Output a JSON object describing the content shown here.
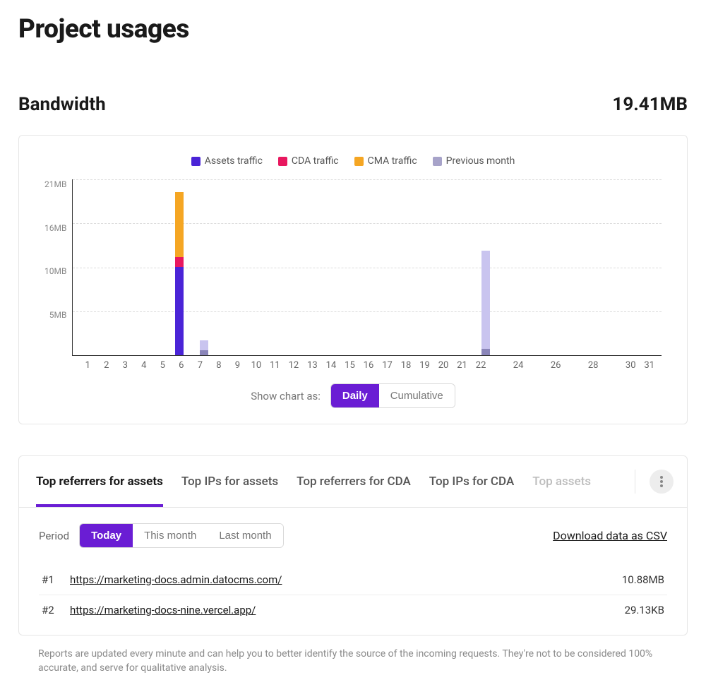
{
  "page": {
    "title": "Project usages"
  },
  "bandwidth": {
    "title": "Bandwidth",
    "total": "19.41MB"
  },
  "chart_data": {
    "type": "bar",
    "ylabel": "",
    "xlabel": "",
    "y_ticks": [
      "21MB",
      "16MB",
      "10MB",
      "5MB",
      ""
    ],
    "y_max_mb": 21,
    "categories": [
      "1",
      "2",
      "3",
      "4",
      "5",
      "6",
      "7",
      "8",
      "9",
      "10",
      "11",
      "12",
      "13",
      "14",
      "15",
      "16",
      "17",
      "18",
      "19",
      "20",
      "21",
      "22",
      "",
      "24",
      "",
      "26",
      "",
      "28",
      "",
      "30",
      "31"
    ],
    "legend": [
      {
        "name": "Assets traffic",
        "color": "#4a24d7"
      },
      {
        "name": "CDA traffic",
        "color": "#e8185f"
      },
      {
        "name": "CMA traffic",
        "color": "#f5a623"
      },
      {
        "name": "Previous month",
        "color": "#a7a3c9"
      }
    ],
    "series": [
      {
        "name": "Assets traffic",
        "values_mb": [
          0,
          0,
          0,
          0,
          0,
          10.5,
          0,
          0,
          0,
          0,
          0,
          0,
          0,
          0,
          0,
          0,
          0,
          0,
          0,
          0,
          0,
          0,
          0,
          0,
          0,
          0,
          0,
          0,
          0,
          0,
          0
        ]
      },
      {
        "name": "CDA traffic",
        "values_mb": [
          0,
          0,
          0,
          0,
          0,
          1.2,
          0,
          0,
          0,
          0,
          0,
          0,
          0,
          0,
          0,
          0,
          0,
          0,
          0,
          0,
          0,
          0,
          0,
          0,
          0,
          0,
          0,
          0,
          0,
          0,
          0
        ]
      },
      {
        "name": "CMA traffic",
        "values_mb": [
          0,
          0,
          0,
          0,
          0,
          7.7,
          0,
          0,
          0,
          0,
          0,
          0,
          0,
          0,
          0,
          0,
          0,
          0,
          0,
          0,
          0,
          0,
          0,
          0,
          0,
          0,
          0,
          0,
          0,
          0,
          0
        ]
      }
    ],
    "previous_month_mb": [
      0,
      0,
      0,
      0,
      0,
      0,
      1.8,
      0,
      0,
      0,
      0,
      0,
      0,
      0,
      0,
      0,
      0,
      0,
      0,
      0,
      0,
      12.5,
      0,
      0,
      0,
      0,
      0,
      0,
      0,
      0,
      0
    ],
    "previous_month_dark_mb": [
      0,
      0,
      0,
      0,
      0,
      0,
      0.6,
      0,
      0,
      0,
      0,
      0,
      0,
      0,
      0,
      0,
      0,
      0,
      0,
      0,
      0,
      0.8,
      0,
      0,
      0,
      0,
      0,
      0,
      0,
      0,
      0
    ]
  },
  "chart_controls": {
    "label": "Show chart as:",
    "options": [
      "Daily",
      "Cumulative"
    ],
    "active": "Daily"
  },
  "tabs": {
    "items": [
      "Top referrers for assets",
      "Top IPs for assets",
      "Top referrers for CDA",
      "Top IPs for CDA",
      "Top assets"
    ],
    "active_index": 0
  },
  "period": {
    "label": "Period",
    "options": [
      "Today",
      "This month",
      "Last month"
    ],
    "active": "Today",
    "download_label": "Download data as CSV"
  },
  "referrers": [
    {
      "rank": "#1",
      "url": "https://marketing-docs.admin.datocms.com/",
      "value": "10.88MB"
    },
    {
      "rank": "#2",
      "url": "https://marketing-docs-nine.vercel.app/",
      "value": "29.13KB"
    }
  ],
  "footnote": "Reports are updated every minute and can help you to better identify the source of the incoming requests. They're not to be considered 100% accurate, and serve for qualitative analysis."
}
